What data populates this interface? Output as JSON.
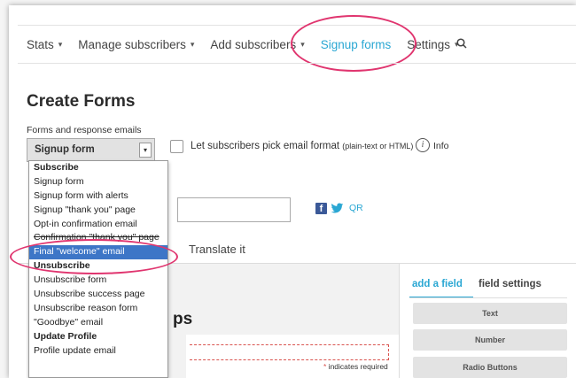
{
  "nav": {
    "items": [
      {
        "label": "Stats",
        "caret": "▾"
      },
      {
        "label": "Manage subscribers",
        "caret": "▾"
      },
      {
        "label": "Add subscribers",
        "caret": "▾"
      },
      {
        "label": "Signup forms",
        "caret": ""
      },
      {
        "label": "Settings",
        "caret": "▾"
      }
    ],
    "active_color": "#2aa7d3",
    "highlight_color": "#e0356f"
  },
  "page_title": "Create Forms",
  "section_label": "Forms and response emails",
  "form_select": {
    "value": "Signup form",
    "arrow": "▾"
  },
  "pick_format": {
    "label": "Let subscribers pick email format",
    "note": "(plain-text or HTML)"
  },
  "info": {
    "icon": "i",
    "label": "Info"
  },
  "share": {
    "facebook_icon": "f",
    "qr_label": "QR"
  },
  "tabs": {
    "translate": "Translate it"
  },
  "builder": {
    "heading": "ps",
    "required_star": "*",
    "required_text": " indicates required"
  },
  "side_panel": {
    "tab_add": "add a field",
    "tab_settings": "field settings",
    "buttons": [
      "Text",
      "Number",
      "Radio Buttons"
    ]
  },
  "dropdown": {
    "items": [
      {
        "label": "Subscribe",
        "group": true
      },
      {
        "label": "Signup form"
      },
      {
        "label": "Signup form with alerts"
      },
      {
        "label": "Signup \"thank you\" page"
      },
      {
        "label": "Opt-in confirmation email"
      },
      {
        "label": "Confirmation \"thank you\" page"
      },
      {
        "label": "Final \"welcome\" email",
        "selected": true
      },
      {
        "label": "Unsubscribe",
        "group": true
      },
      {
        "label": "Unsubscribe form"
      },
      {
        "label": "Unsubscribe success page"
      },
      {
        "label": "Unsubscribe reason form"
      },
      {
        "label": "\"Goodbye\" email"
      },
      {
        "label": "Update Profile",
        "group": true
      },
      {
        "label": "Profile update email"
      }
    ],
    "selected_color": "#3d76c7"
  }
}
